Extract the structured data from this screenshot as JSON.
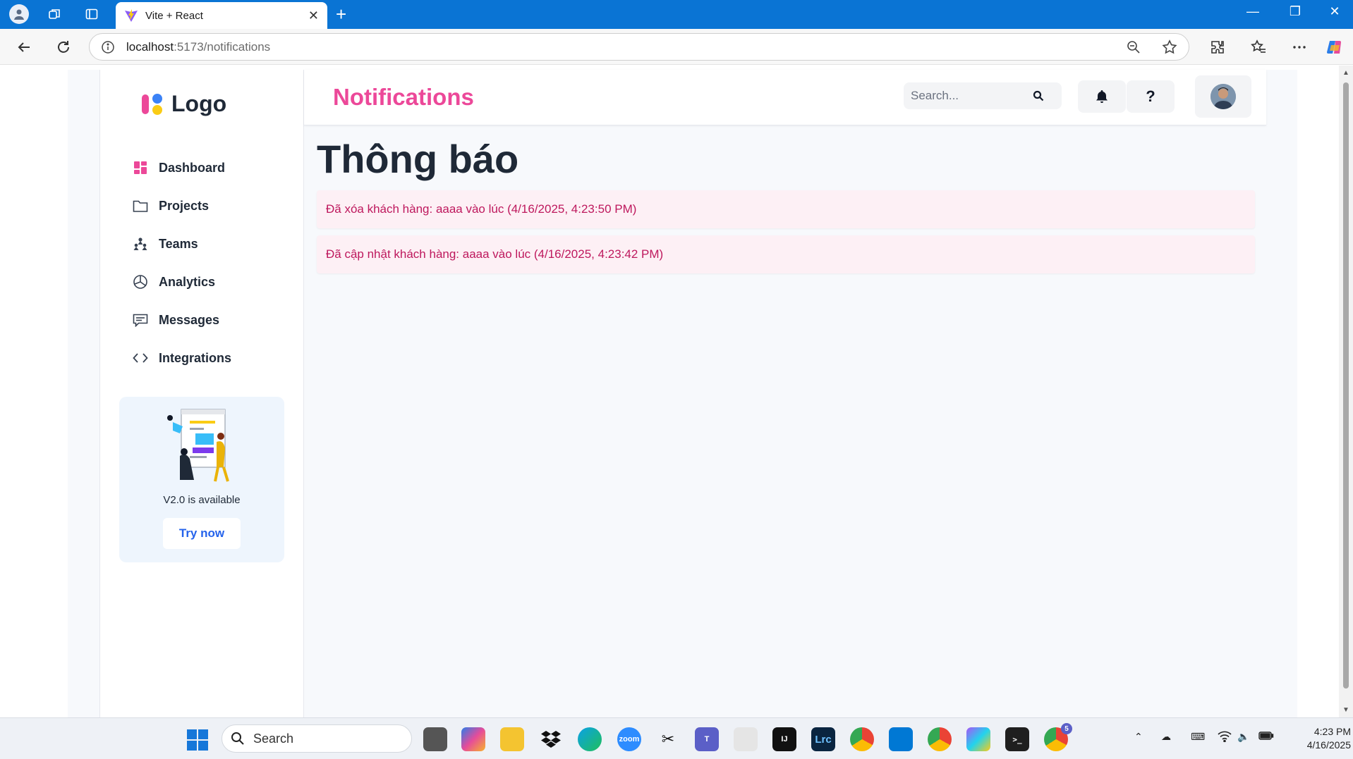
{
  "browser": {
    "tab_title": "Vite + React",
    "url_host": "localhost",
    "url_rest": ":5173/notifications"
  },
  "sidebar": {
    "logo_text": "Logo",
    "items": [
      {
        "label": "Dashboard",
        "icon": "dashboard-icon"
      },
      {
        "label": "Projects",
        "icon": "folder-icon"
      },
      {
        "label": "Teams",
        "icon": "teams-icon"
      },
      {
        "label": "Analytics",
        "icon": "pie-chart-icon"
      },
      {
        "label": "Messages",
        "icon": "message-icon"
      },
      {
        "label": "Integrations",
        "icon": "code-icon"
      }
    ],
    "promo": {
      "text": "V2.0 is available",
      "button": "Try now"
    }
  },
  "header": {
    "title": "Notifications",
    "search_placeholder": "Search...",
    "help_label": "?"
  },
  "content": {
    "heading": "Thông báo",
    "notifications": [
      {
        "text": "Đã xóa khách hàng: aaaa vào lúc (4/16/2025, 4:23:50 PM)"
      },
      {
        "text": "Đã cập nhật khách hàng: aaaa vào lúc (4/16/2025, 4:23:42 PM)"
      }
    ]
  },
  "taskbar": {
    "search_label": "Search",
    "time": "4:23 PM",
    "date": "4/16/2025",
    "zoom_label": "zoom",
    "lrc_label": "Lrc",
    "chrome_badge": "5"
  },
  "colors": {
    "accent_pink": "#ec4899",
    "notif_bg": "#fdf0f5",
    "notif_text": "#be185d",
    "link_blue": "#2563eb",
    "browser_blue": "#0a74d4"
  }
}
